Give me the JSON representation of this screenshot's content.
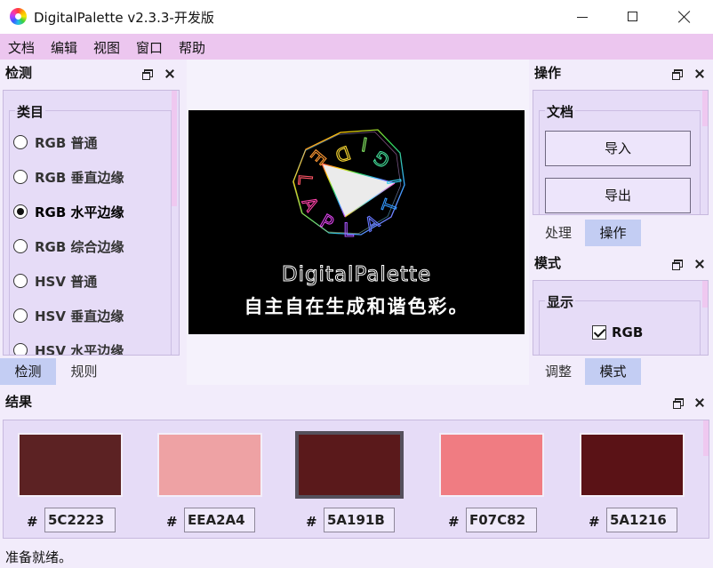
{
  "window": {
    "title": "DigitalPalette v2.3.3-开发版",
    "minimize_icon": "minimize-icon",
    "maximize_icon": "maximize-icon",
    "close_icon": "close-icon"
  },
  "menu": [
    "文档",
    "编辑",
    "视图",
    "窗口",
    "帮助"
  ],
  "detect_dock": {
    "title": "检测",
    "group_label": "类目",
    "options": [
      {
        "label": "RGB 普通",
        "checked": false
      },
      {
        "label": "RGB 垂直边缘",
        "checked": false
      },
      {
        "label": "RGB 水平边缘",
        "checked": true
      },
      {
        "label": "RGB 综合边缘",
        "checked": false
      },
      {
        "label": "HSV 普通",
        "checked": false
      },
      {
        "label": "HSV 垂直边缘",
        "checked": false
      },
      {
        "label": "HSV 水平边缘",
        "checked": false
      }
    ],
    "tabs": [
      {
        "label": "检测",
        "active": true
      },
      {
        "label": "规则",
        "active": false
      }
    ]
  },
  "viewport": {
    "caption_title": "DigitalPalette",
    "caption_subtitle": "自主自在生成和谐色彩。",
    "logo_letters": [
      "D",
      "I",
      "G",
      "I",
      "T",
      "A",
      "L",
      "P",
      "A",
      "L",
      "E"
    ]
  },
  "operate_dock": {
    "title": "操作",
    "group_label": "文档",
    "import_label": "导入",
    "export_label": "导出",
    "tabs": [
      {
        "label": "处理",
        "active": false
      },
      {
        "label": "操作",
        "active": true
      }
    ]
  },
  "mode_dock": {
    "title": "模式",
    "group_label": "显示",
    "checkbox_label": "RGB",
    "checkbox_checked": true,
    "tabs": [
      {
        "label": "调整",
        "active": false
      },
      {
        "label": "模式",
        "active": true
      }
    ]
  },
  "results_dock": {
    "title": "结果",
    "hash": "#",
    "swatches": [
      {
        "hex": "5C2223",
        "color": "#5C2223",
        "selected": false
      },
      {
        "hex": "EEA2A4",
        "color": "#EEA2A4",
        "selected": false
      },
      {
        "hex": "5A191B",
        "color": "#5A191B",
        "selected": true
      },
      {
        "hex": "F07C82",
        "color": "#F07C82",
        "selected": false
      },
      {
        "hex": "5A1216",
        "color": "#5A1216",
        "selected": false
      }
    ]
  },
  "status": "准备就绪。",
  "colors": {
    "menubar": "#ECC6EF",
    "panel": "#E6DCF7",
    "active_tab": "#C3CDF3",
    "window_bg": "#F2ECFB"
  }
}
